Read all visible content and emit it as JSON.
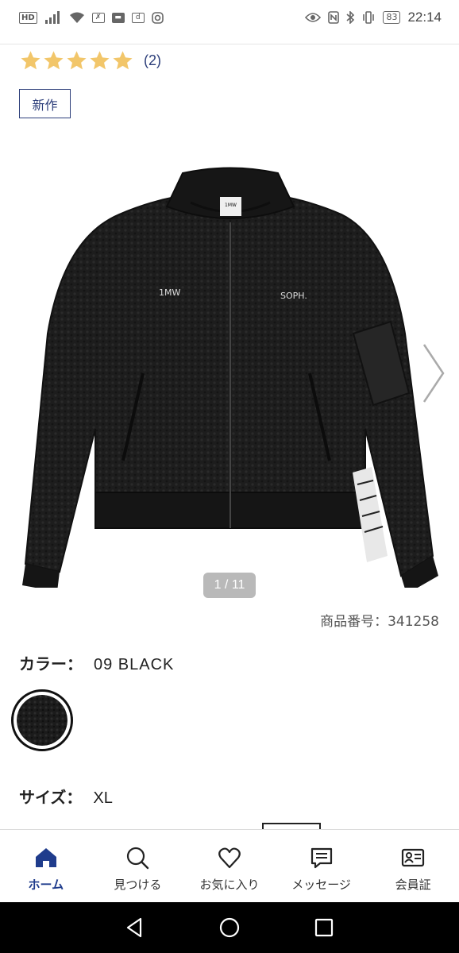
{
  "status_bar": {
    "left_icons": [
      "hd-icon",
      "signal-icon",
      "wifi-icon",
      "app-icon",
      "app-icon",
      "app-icon",
      "instagram-icon"
    ],
    "hd_label": "HD",
    "right_icons": [
      "eye-icon",
      "nfc-icon",
      "bluetooth-icon",
      "vibrate-icon"
    ],
    "battery": "83",
    "time": "22:14"
  },
  "product": {
    "review_count": "(2)",
    "rating": 5,
    "badge": "新作",
    "image_pager": "1 / 11",
    "product_number": "商品番号：341258",
    "jacket_text_left": "1MW",
    "jacket_text_right": "SOPH.",
    "color_label": "カラー：",
    "color_value": "09 BLACK",
    "size_label": "サイズ：",
    "size_value": "XL"
  },
  "bottom_nav": {
    "items": [
      {
        "label": "ホーム",
        "icon": "home-icon",
        "active": true
      },
      {
        "label": "見つける",
        "icon": "search-icon",
        "active": false
      },
      {
        "label": "お気に入り",
        "icon": "heart-icon",
        "active": false
      },
      {
        "label": "メッセージ",
        "icon": "message-icon",
        "active": false
      },
      {
        "label": "会員証",
        "icon": "member-card-icon",
        "active": false
      }
    ]
  },
  "colors": {
    "accent": "#1f3c8c",
    "star": "#f2c66a",
    "system_bar": "#000000"
  },
  "system_nav": [
    "back-icon",
    "home-circle-icon",
    "recents-icon"
  ]
}
